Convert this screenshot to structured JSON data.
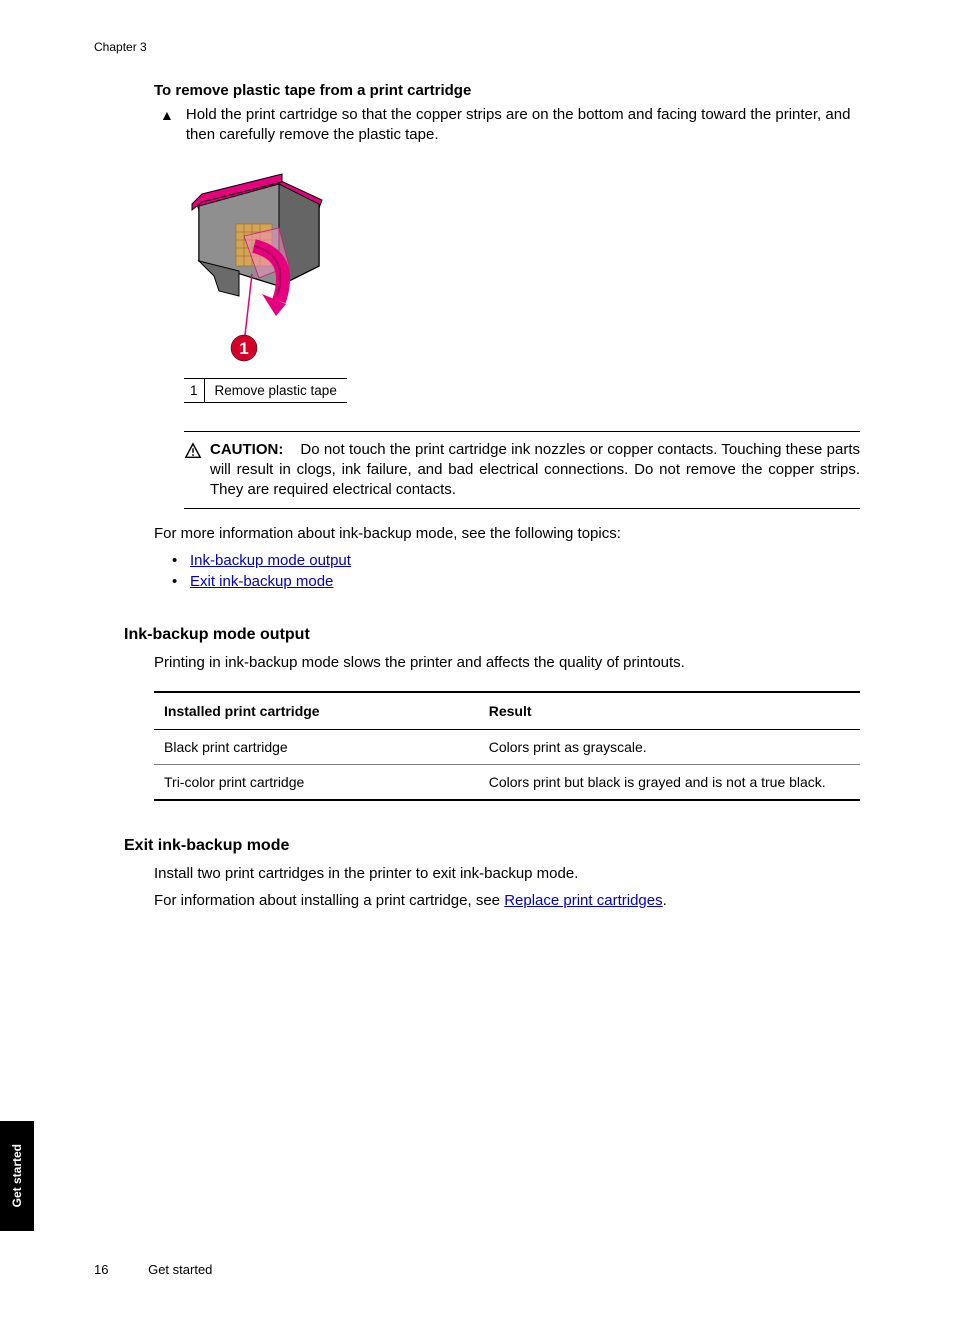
{
  "header": {
    "chapter": "Chapter 3"
  },
  "section1": {
    "title": "To remove plastic tape from a print cartridge",
    "step_marker": "▲",
    "step_text": "Hold the print cartridge so that the copper strips are on the bottom and facing toward the printer, and then carefully remove the plastic tape.",
    "callout_num": "1",
    "callout_text": "Remove plastic tape"
  },
  "caution": {
    "label": "CAUTION:",
    "text": "Do not touch the print cartridge ink nozzles or copper contacts. Touching these parts will result in clogs, ink failure, and bad electrical connections. Do not remove the copper strips. They are required electrical contacts."
  },
  "followup": "For more information about ink-backup mode, see the following topics:",
  "links": [
    "Ink-backup mode output",
    "Exit ink-backup mode"
  ],
  "section2": {
    "heading": "Ink-backup mode output",
    "body": "Printing in ink-backup mode slows the printer and affects the quality of printouts.",
    "table": {
      "head": [
        "Installed print cartridge",
        "Result"
      ],
      "rows": [
        [
          "Black print cartridge",
          "Colors print as grayscale."
        ],
        [
          "Tri-color print cartridge",
          "Colors print but black is grayed and is not a true black."
        ]
      ]
    }
  },
  "section3": {
    "heading": "Exit ink-backup mode",
    "line1": "Install two print cartridges in the printer to exit ink-backup mode.",
    "line2_pre": "For information about installing a print cartridge, see ",
    "line2_link": "Replace print cartridges",
    "line2_post": "."
  },
  "footer": {
    "page": "16",
    "section": "Get started"
  },
  "sidetab": "Get started"
}
